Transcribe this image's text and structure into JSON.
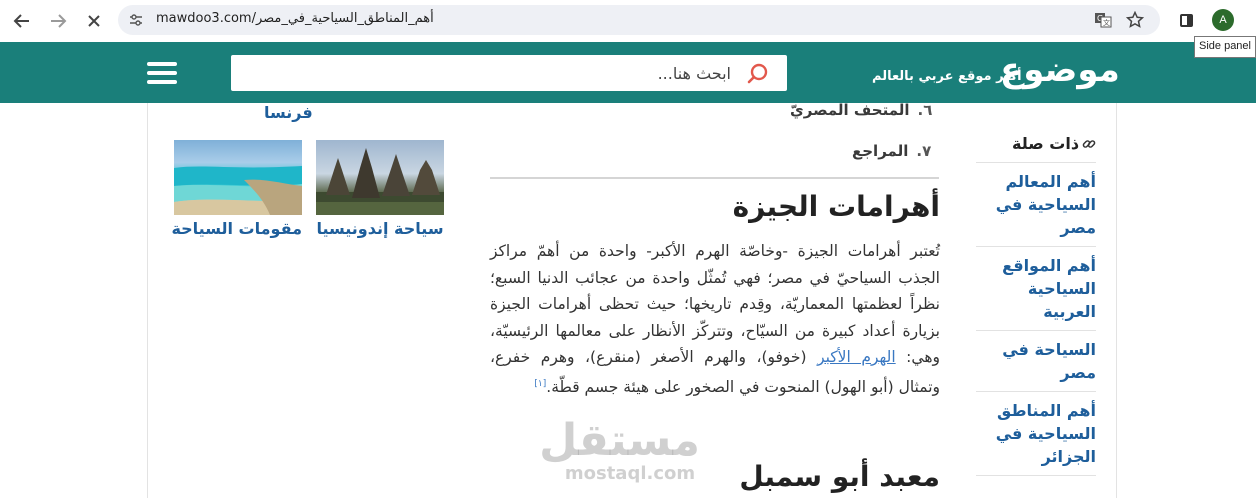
{
  "browser": {
    "url": "mawdoo3.com/أهم_المناطق_السياحية_في_مصر",
    "avatar_letter": "A",
    "tooltip": "Side panel"
  },
  "header": {
    "logo": "موضوع",
    "tagline": "أكبر موقع عربي بالعالم",
    "search_placeholder": "ابحث هنا..."
  },
  "sidebar": {
    "title": "ذات صلة",
    "items": [
      "أهم المعالم السياحية في مصر",
      "أهم المواقع السياحية العربية",
      "السياحة في مصر",
      "أهم المناطق السياحية في الجزائر"
    ]
  },
  "toc": {
    "item6_num": "٦.",
    "item6_label": "المتحف المصريّ",
    "item7_num": "٧.",
    "item7_label": "المراجع"
  },
  "article": {
    "giza_heading": "أهرامات الجيزة",
    "giza_text_1": "تُعتبر أهرامات الجيزة -وخاصّة الهرم الأكبر- واحدة من أهمّ مراكز الجذب السياحيّ في مصر؛ فهي تُمثّل واحدة من عجائب الدنيا السبع؛ نظراً لعظمتها المعماريّة، وقِدم تاريخها؛ حيث تحظى أهرامات الجيزة بزيارة أعداد كبيرة من السيّاح، وتتركّز الأنظار على معالمها الرئيسيّة، وهي: ",
    "giza_link": "الهرم الأكبر",
    "giza_text_2": " (خوفو)، والهرم الأصغر (منقرع)، وهرم خفرع، وتمثال (أبو الهول) المنحوت في الصخور على هيئة جسم قطّة.",
    "giza_ref": "[١]",
    "abu_heading": "معبد أبو سمبل"
  },
  "related_cards": {
    "top_label": "فرنسا",
    "cards": [
      {
        "label": "سياحة إندونيسيا"
      },
      {
        "label": "مقومات السياحة"
      }
    ]
  },
  "watermark": {
    "arabic": "مستقل",
    "latin": "mostaql.com"
  }
}
